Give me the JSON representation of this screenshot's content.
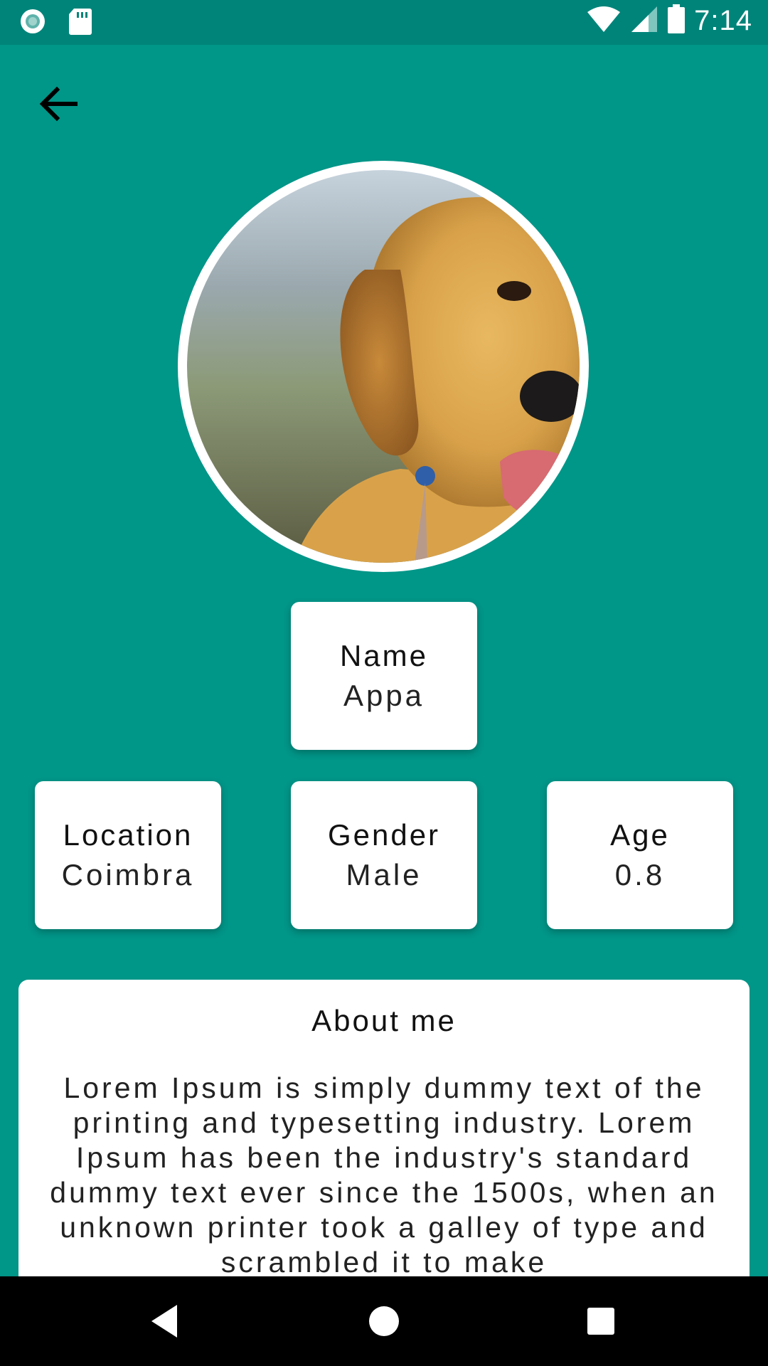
{
  "status_bar": {
    "time": "7:14",
    "icons": [
      "circle-notification-icon",
      "sd-card-icon",
      "wifi-icon",
      "cellular-signal-icon",
      "battery-icon"
    ]
  },
  "header": {
    "back_icon": "arrow-back-icon"
  },
  "profile": {
    "photo": "golden-retriever-puppy-photo",
    "name_label": "Name",
    "name_value": "Appa",
    "location_label": "Location",
    "location_value": "Coimbra",
    "gender_label": "Gender",
    "gender_value": "Male",
    "age_label": "Age",
    "age_value": "0.8"
  },
  "about": {
    "title": "About me",
    "body": "Lorem Ipsum is simply dummy text of the printing and typesetting industry. Lorem Ipsum has been the industry's standard dummy text ever since the 1500s, when an unknown printer took a galley of type and scrambled it to make"
  },
  "nav_bar": {
    "back_icon": "triangle-back-icon",
    "home_icon": "circle-home-icon",
    "recents_icon": "square-recents-icon"
  },
  "colors": {
    "background": "#009688",
    "status_bar": "#00847A",
    "card": "#FFFFFF",
    "nav_bar": "#000000"
  }
}
